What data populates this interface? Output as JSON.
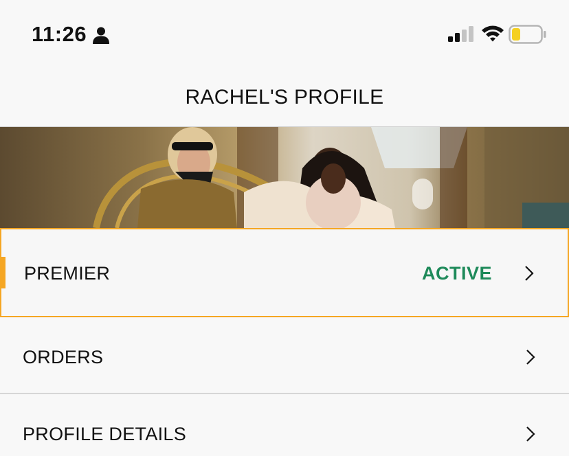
{
  "status_bar": {
    "time": "11:26",
    "icons": [
      "person-icon",
      "cellular-signal-icon",
      "wifi-icon",
      "battery-icon"
    ],
    "battery_color": "#f5d020"
  },
  "header": {
    "title": "RACHEL'S PROFILE"
  },
  "banner": {
    "icon": "promo-banner-image"
  },
  "menu": {
    "items": [
      {
        "label": "PREMIER",
        "status": "ACTIVE",
        "icon": "chevron-right-icon"
      },
      {
        "label": "ORDERS",
        "icon": "chevron-right-icon"
      },
      {
        "label": "PROFILE DETAILS",
        "icon": "chevron-right-icon"
      }
    ]
  },
  "colors": {
    "accent": "#f5a623",
    "active_status": "#1e8a5a",
    "background": "#f8f8f8",
    "divider": "#d6d6d6"
  }
}
